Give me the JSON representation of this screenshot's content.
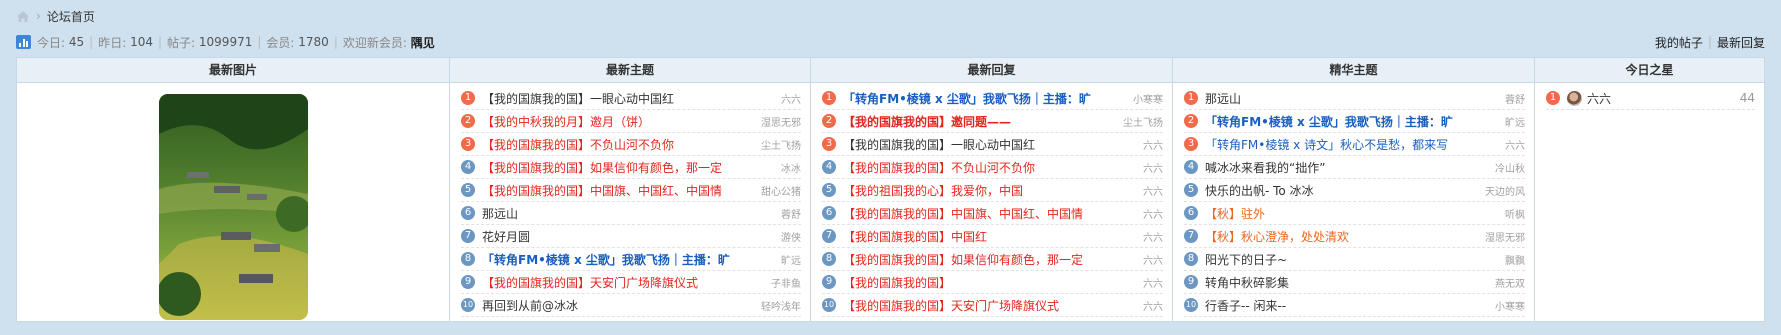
{
  "breadcrumb": {
    "current": "论坛首页"
  },
  "stats": {
    "today_label": "今日:",
    "today_value": "45",
    "yesterday_label": "昨日:",
    "yesterday_value": "104",
    "posts_label": "帖子:",
    "posts_value": "1099971",
    "members_label": "会员:",
    "members_value": "1780",
    "welcome_label": "欢迎新会员:",
    "new_member": "隅见"
  },
  "toplinks": {
    "my_posts": "我的帖子",
    "latest_reply": "最新回复"
  },
  "columns": {
    "image": {
      "heading": "最新图片"
    },
    "latest_topics": {
      "heading": "最新主题",
      "items": [
        {
          "rank": "1",
          "title": "【我的国旗我的国】一眼心动中国红",
          "author": "六六",
          "color": "dark"
        },
        {
          "rank": "2",
          "title": "【我的中秋我的月】邀月（饼）",
          "author": "湿思无邪",
          "color": "red"
        },
        {
          "rank": "3",
          "title": "【我的国旗我的国】不负山河不负你",
          "author": "尘土飞扬",
          "color": "red"
        },
        {
          "rank": "4",
          "title": "【我的国旗我的国】如果信仰有颜色，那一定",
          "author": "冰冰",
          "color": "red"
        },
        {
          "rank": "5",
          "title": "【我的国旗我的国】中国旗、中国红、中国情",
          "author": "甜心公猪",
          "color": "red"
        },
        {
          "rank": "6",
          "title": "那远山",
          "author": "蓉舒",
          "color": "dark"
        },
        {
          "rank": "7",
          "title": "花好月圆",
          "author": "游侠",
          "color": "dark"
        },
        {
          "rank": "8",
          "title": "「转角FM•棱镜 x 尘歌」我歌飞扬｜主播：旷",
          "author": "旷远",
          "color": "blue"
        },
        {
          "rank": "9",
          "title": "【我的国旗我的国】天安门广场降旗仪式",
          "author": "子非鱼",
          "color": "red"
        },
        {
          "rank": "10",
          "title": "再回到从前@冰冰",
          "author": "轻吟浅年",
          "color": "dark"
        }
      ]
    },
    "latest_replies": {
      "heading": "最新回复",
      "items": [
        {
          "rank": "1",
          "title": "「转角FM•棱镜 x 尘歌」我歌飞扬｜主播：旷",
          "author": "小寒寒",
          "color": "blue"
        },
        {
          "rank": "2",
          "title": "【我的国旗我的国】邀同题——",
          "author": "尘土飞扬",
          "color": "redb"
        },
        {
          "rank": "3",
          "title": "【我的国旗我的国】一眼心动中国红",
          "author": "六六",
          "color": "dark"
        },
        {
          "rank": "4",
          "title": "【我的国旗我的国】不负山河不负你",
          "author": "六六",
          "color": "red"
        },
        {
          "rank": "5",
          "title": "【我的祖国我的心】我爱你，中国",
          "author": "六六",
          "color": "red"
        },
        {
          "rank": "6",
          "title": "【我的国旗我的国】中国旗、中国红、中国情",
          "author": "六六",
          "color": "red"
        },
        {
          "rank": "7",
          "title": "【我的国旗我的国】中国红",
          "author": "六六",
          "color": "red"
        },
        {
          "rank": "8",
          "title": "【我的国旗我的国】如果信仰有颜色，那一定",
          "author": "六六",
          "color": "red"
        },
        {
          "rank": "9",
          "title": "【我的国旗我的国】",
          "author": "六六",
          "color": "red"
        },
        {
          "rank": "10",
          "title": "【我的国旗我的国】天安门广场降旗仪式",
          "author": "六六",
          "color": "red"
        }
      ]
    },
    "featured": {
      "heading": "精华主题",
      "items": [
        {
          "rank": "1",
          "title": "那远山",
          "author": "蓉舒",
          "color": "dark"
        },
        {
          "rank": "2",
          "title": "「转角FM•棱镜 x 尘歌」我歌飞扬｜主播：旷",
          "author": "旷远",
          "color": "blue"
        },
        {
          "rank": "3",
          "title": "「转角FM•棱镜 x 诗文」秋心不是愁，都来写",
          "author": "六六",
          "color": "blue-plain"
        },
        {
          "rank": "4",
          "title": "喊冰冰来看我的“拙作”",
          "author": "冷山秋",
          "color": "dark"
        },
        {
          "rank": "5",
          "title": "快乐的出帆- To 冰冰",
          "author": "天边的风",
          "color": "dark"
        },
        {
          "rank": "6",
          "title": "【秋】驻外",
          "author": "听枫",
          "color": "orange"
        },
        {
          "rank": "7",
          "title": "【秋】秋心澄净，处处清欢",
          "author": "湿思无邪",
          "color": "orange"
        },
        {
          "rank": "8",
          "title": "阳光下的日子~",
          "author": "飘飘",
          "color": "dark"
        },
        {
          "rank": "9",
          "title": "转角中秋碎影集",
          "author": "燕无双",
          "color": "dark"
        },
        {
          "rank": "10",
          "title": "行香子-- 闲来--",
          "author": "小寒寒",
          "color": "dark"
        }
      ]
    },
    "star": {
      "heading": "今日之星",
      "items": [
        {
          "rank": "1",
          "name": "六六",
          "count": "44"
        }
      ]
    }
  },
  "colors": {
    "accent_red": "#f16a4a",
    "rank_blue": "#6b97c2",
    "title_red": "#e2261d",
    "title_blue": "#1a5fbf",
    "title_orange": "#f0651d",
    "header_bg": "#e7f0f7",
    "page_bg": "#cfe0ee"
  },
  "icons": {
    "home": "home-icon",
    "stats": "bar-chart-icon"
  }
}
